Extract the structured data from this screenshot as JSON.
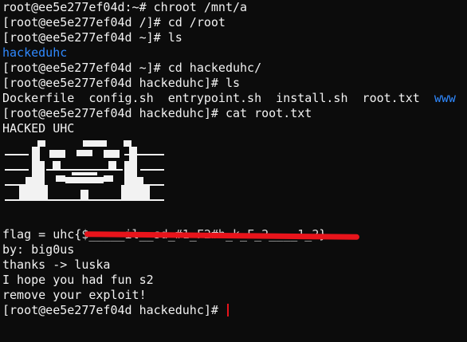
{
  "terminal": {
    "lines": [
      {
        "text": "root@ee5e277ef04d:~# chroot /mnt/a"
      },
      {
        "text": "[root@ee5e277ef04d /]# cd /root"
      },
      {
        "text": "[root@ee5e277ef04d ~]# ls"
      },
      {
        "text": "hackeduhc",
        "type": "dir"
      },
      {
        "text": "[root@ee5e277ef04d ~]# cd hackeduhc/"
      },
      {
        "text": "[root@ee5e277ef04d hackeduhc]# ls"
      },
      {
        "text": "Dockerfile  config.sh  entrypoint.sh  install.sh  root.txt  ",
        "dir_suffix": "www"
      },
      {
        "text": "[root@ee5e277ef04d hackeduhc]# cat root.txt"
      },
      {
        "text": "HACKED UHC"
      }
    ],
    "flag_prefix": "flag = uhc{",
    "flag_hidden": "$_____il__sd_#1_F2#h_k_F_2____1_2",
    "flag_suffix": "}",
    "after_lines": [
      {
        "text": "by: big0us"
      },
      {
        "text": "thanks -> luska"
      },
      {
        "text": "I hope you had fun s2"
      },
      {
        "text": "remove your exploit!"
      }
    ],
    "final_prompt": "[root@ee5e277ef04d hackeduhc]# "
  },
  "colors": {
    "background": "#0c0c0c",
    "foreground": "#f2f2f2",
    "directory": "#2f89ff",
    "redaction": "#e8141b",
    "cursor": "#e8141b"
  }
}
